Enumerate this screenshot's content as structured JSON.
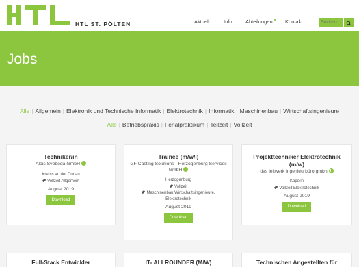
{
  "header": {
    "logo_text": "HTL ST. PÖLTEN",
    "nav": [
      "Aktuell",
      "Info",
      "Abteilungen",
      "Kontakt"
    ],
    "search_placeholder": "Suchen"
  },
  "banner": {
    "title": "Jobs"
  },
  "filters": {
    "departments": [
      "Alle",
      "Allgemein",
      "Elektronik und Technische Informatik",
      "Elektrotechnik",
      "Informatik",
      "Maschinenbau",
      "Wirtschaftsingenieure"
    ],
    "types": [
      "Alle",
      "Betriebspraxis",
      "Ferialpraktikum",
      "Teilzeit",
      "Vollzeit"
    ]
  },
  "jobs": [
    {
      "title": "Techniker/in",
      "company": "Alois Svoboda GmbH",
      "location": "Krems an der Donau",
      "tags": "Vollzeit  Allgemein",
      "date": "August 2019",
      "button": "Download"
    },
    {
      "title": "Trainee (m/w/i)",
      "company": "GF Casting Solutions - Herzogenburg Services GmbH",
      "location": "Herzogenburg",
      "tag_type": "Vollzeit",
      "tag_dept": "Maschinenbau,Wirtschaftsingenieure, Elektrotechnik",
      "date": "August 2019",
      "button": "Download"
    },
    {
      "title": "Projekttechniker Elektrotechnik (m/w)",
      "company": "das leitwerk ingenieurbüro gmbh",
      "location": "Kapelln",
      "tags": "Vollzeit  Elektrotechnik",
      "date": "August 2019",
      "button": "Download"
    },
    {
      "title": "Full-Stack Entwickler"
    },
    {
      "title": "IT- ALLROUNDER (M/W)"
    },
    {
      "title": "Technischen Angestellten für"
    }
  ]
}
